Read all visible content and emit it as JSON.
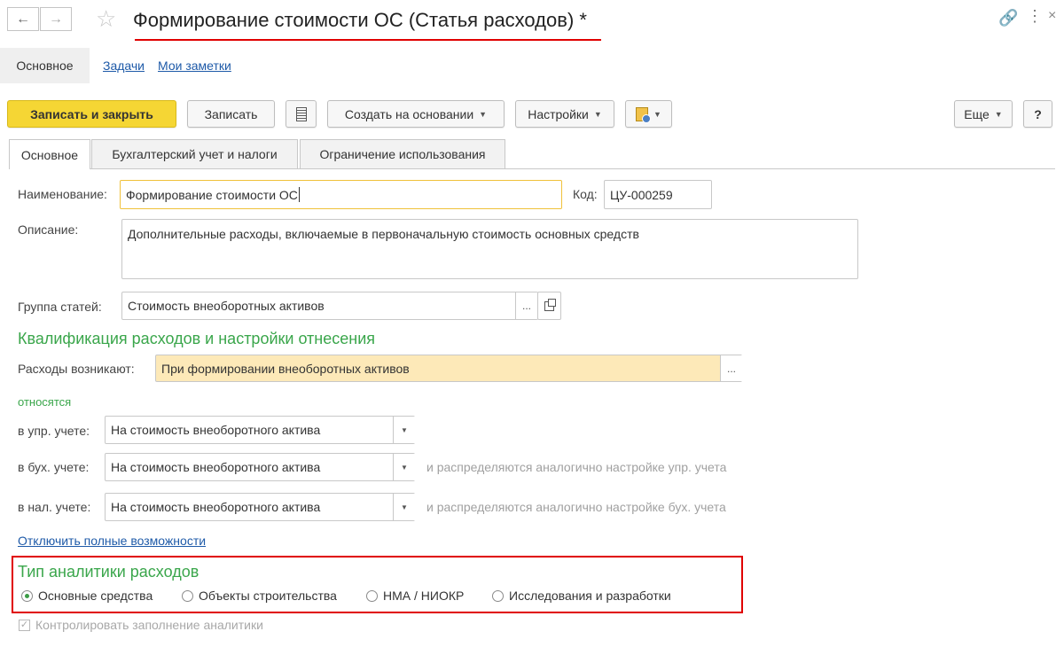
{
  "window": {
    "title": "Формирование стоимости ОС (Статья расходов) *",
    "accent_underline_color": "#e00000"
  },
  "nav_links": {
    "main": "Основное",
    "tasks": "Задачи",
    "notes": "Мои заметки"
  },
  "toolbar": {
    "save_close": "Записать и закрыть",
    "save": "Записать",
    "create_based": "Создать на основании",
    "settings": "Настройки",
    "more": "Еще",
    "help": "?"
  },
  "tabs": [
    {
      "label": "Основное"
    },
    {
      "label": "Бухгалтерский учет и налоги"
    },
    {
      "label": "Ограничение использования"
    }
  ],
  "form": {
    "name_label": "Наименование:",
    "name_value": "Формирование стоимости ОС",
    "code_label": "Код:",
    "code_value": "ЦУ-000259",
    "description_label": "Описание:",
    "description_value": "Дополнительные расходы, включаемые в первоначальную стоимость основных средств",
    "group_label": "Группа статей:",
    "group_value": "Стоимость внеоборотных активов",
    "ellipsis": "...",
    "qualification_title": "Квалификация расходов и настройки отнесения",
    "arise_label": "Расходы возникают:",
    "arise_value": "При формировании внеоборотных активов",
    "relate_title": "относятся",
    "mgmt_label": "в упр. учете:",
    "mgmt_value": "На стоимость внеоборотного актива",
    "acc_label": "в бух. учете:",
    "acc_value": "На стоимость внеоборотного актива",
    "acc_hint": "и распределяются аналогично настройке упр. учета",
    "tax_label": "в нал. учете:",
    "tax_value": "На стоимость внеоборотного актива",
    "tax_hint": "и распределяются аналогично настройке бух. учета",
    "disable_link": "Отключить полные возможности",
    "analytics_title": "Тип аналитики расходов",
    "analytics_options": [
      {
        "label": "Основные средства",
        "checked": true
      },
      {
        "label": "Объекты строительства",
        "checked": false
      },
      {
        "label": "НМА / НИОКР",
        "checked": false
      },
      {
        "label": "Исследования и разработки",
        "checked": false
      }
    ],
    "control_checkbox": "Контролировать заполнение аналитики"
  },
  "colors": {
    "primary_button": "#f5d634",
    "section_title": "#3aa64b",
    "highlight_box": "#e00000",
    "arise_field_bg": "#fde9b8"
  }
}
